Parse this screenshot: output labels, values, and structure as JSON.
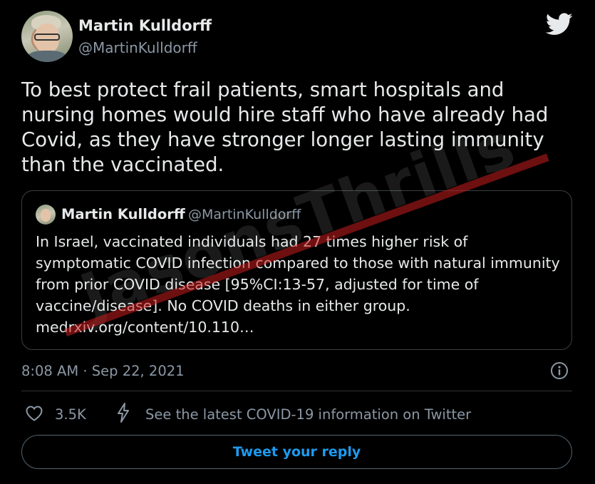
{
  "author": {
    "name": "Martin Kulldorff",
    "handle": "@MartinKulldorff"
  },
  "tweet": {
    "text": "To best protect frail patients, smart hospitals and nursing homes would hire staff who have already had Covid, as they have stronger longer lasting immunity than the vaccinated.",
    "timestamp": "8:08 AM · Sep 22, 2021"
  },
  "quoted_tweet": {
    "name": "Martin Kulldorff",
    "handle": "@MartinKulldorff",
    "text": "In Israel, vaccinated individuals had 27 times higher risk of symptomatic COVID infection compared to those with natural immunity from prior COVID disease [95%CI:13-57, adjusted for time of vaccine/disease]. No COVID deaths in either group.",
    "link": "medrxiv.org/content/10.110…"
  },
  "actions": {
    "likes": "3.5K",
    "covid_info": "See the latest COVID-19 information on Twitter",
    "reply_button": "Tweet your reply"
  },
  "watermark": "JasonsThrills",
  "colors": {
    "background": "#000000",
    "text": "#e7e9ea",
    "muted": "#8b98a5",
    "accent": "#1d9bf0",
    "bird": "#e7e9ea"
  },
  "icons": {
    "logo": "twitter-bird-icon",
    "info": "info-icon",
    "like": "heart-icon",
    "covid": "lightning-bolt-icon"
  }
}
